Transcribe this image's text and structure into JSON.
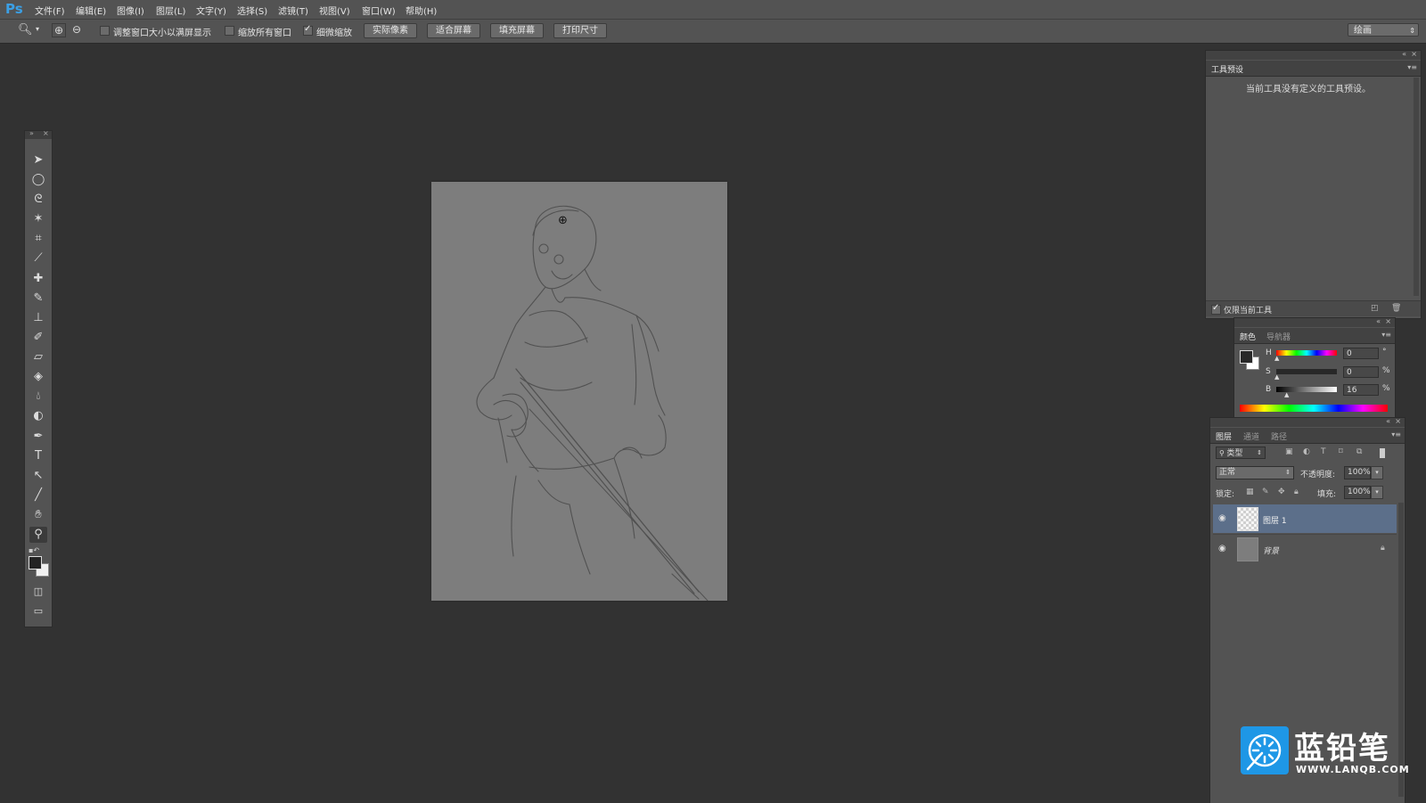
{
  "app": {
    "logo": "Ps"
  },
  "menu": [
    {
      "label": "文件(F)"
    },
    {
      "label": "编辑(E)"
    },
    {
      "label": "图像(I)"
    },
    {
      "label": "图层(L)"
    },
    {
      "label": "文字(Y)"
    },
    {
      "label": "选择(S)"
    },
    {
      "label": "滤镜(T)"
    },
    {
      "label": "视图(V)"
    },
    {
      "label": "窗口(W)"
    },
    {
      "label": "帮助(H)"
    }
  ],
  "options": {
    "resize_windows_label": "调整窗口大小以满屏显示",
    "resize_windows_checked": false,
    "zoom_all_label": "缩放所有窗口",
    "zoom_all_checked": false,
    "scrubby_label": "细微缩放",
    "scrubby_checked": true,
    "buttons": [
      "实际像素",
      "适合屏幕",
      "填充屏幕",
      "打印尺寸"
    ],
    "workspace": "绘画"
  },
  "toolbox": {
    "tools": [
      "move-tool",
      "marquee-tool",
      "lasso-tool",
      "magic-wand-tool",
      "crop-tool",
      "eyedropper-tool",
      "healing-brush-tool",
      "brush-tool",
      "clone-stamp-tool",
      "history-brush-tool",
      "eraser-tool",
      "paint-bucket-tool",
      "blur-tool",
      "dodge-tool",
      "pen-tool",
      "type-tool",
      "path-selection-tool",
      "line-tool",
      "hand-tool",
      "zoom-tool"
    ],
    "active": "zoom-tool"
  },
  "tool_presets": {
    "title": "工具预设",
    "message": "当前工具没有定义的工具预设。",
    "current_only_label": "仅限当前工具",
    "current_only_checked": true
  },
  "color_panel": {
    "tabs": [
      "颜色",
      "导航器"
    ],
    "h_label": "H",
    "h_value": "0",
    "h_unit": "°",
    "s_label": "S",
    "s_value": "0",
    "s_unit": "%",
    "b_label": "B",
    "b_value": "16",
    "b_unit": "%",
    "foreground": "#292929",
    "background": "#ffffff"
  },
  "layers_panel": {
    "tabs": [
      "图层",
      "通道",
      "路径"
    ],
    "filter_kind": "类型",
    "blend_mode": "正常",
    "opacity_label": "不透明度:",
    "opacity": "100%",
    "lock_label": "锁定:",
    "fill_label": "填充:",
    "fill": "100%",
    "layers": [
      {
        "name": "图层 1",
        "selected": true,
        "visible": true,
        "locked": false
      },
      {
        "name": "背景",
        "selected": false,
        "visible": true,
        "locked": true
      }
    ]
  },
  "watermark": {
    "brand": "蓝铅笔",
    "url": "WWW.LANQB.COM"
  }
}
